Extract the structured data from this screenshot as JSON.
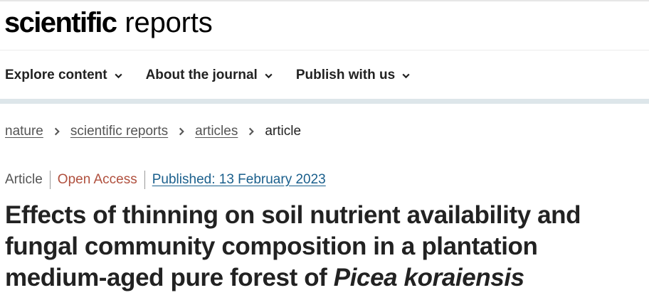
{
  "brand": {
    "bold": "scientific",
    "light": "reports"
  },
  "nav": [
    {
      "label": "Explore content"
    },
    {
      "label": "About the journal"
    },
    {
      "label": "Publish with us"
    }
  ],
  "breadcrumb": {
    "items": [
      "nature",
      "scientific reports",
      "articles"
    ],
    "current": "article"
  },
  "meta": {
    "type": "Article",
    "access": "Open Access",
    "published": "Published: 13 February 2023"
  },
  "title": {
    "text": "Effects of thinning on soil nutrient availability and fungal community composition in a plantation medium-aged pure forest of ",
    "species": "Picea koraiensis"
  },
  "colors": {
    "open_access": "#b0503e",
    "published_link": "#1a5f8c",
    "nav_band": "#dde6ea"
  }
}
